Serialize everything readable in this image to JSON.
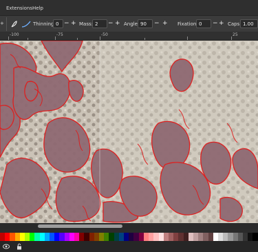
{
  "menu": {
    "items": [
      "Extensions",
      "Help"
    ]
  },
  "toolbar": {
    "thinning": {
      "label": "Thinning:",
      "value": "0"
    },
    "mass": {
      "label": "Mass:",
      "value": "2"
    },
    "angle": {
      "label": "Angle:",
      "value": "90"
    },
    "fixation": {
      "label": "Fixation:",
      "value": "0"
    },
    "caps": {
      "label": "Caps:",
      "value": "1.00"
    },
    "minus": "−",
    "plus": "+"
  },
  "ruler": {
    "labels": [
      "-100",
      "-75",
      "-50",
      "25"
    ]
  },
  "palette": {
    "colors": [
      "#c00000",
      "#ff0000",
      "#ff5500",
      "#ffaa00",
      "#ffff00",
      "#aaff00",
      "#00ff00",
      "#00ffaa",
      "#00ffff",
      "#00aaff",
      "#0055ff",
      "#0000ff",
      "#5500ff",
      "#aa00ff",
      "#ff00ff",
      "#ff00aa",
      "#800000",
      "#400000",
      "#802000",
      "#804000",
      "#808000",
      "#408000",
      "#004000",
      "#004040",
      "#004080",
      "#000080",
      "#200040",
      "#400040",
      "#800040",
      "#ff8080",
      "#ffa0a0",
      "#ffc0c0",
      "#ffe0e0",
      "#c08080",
      "#a06060",
      "#804040",
      "#603030",
      "#402020",
      "#e0c0c0",
      "#c0a0a0",
      "#a08080",
      "#806060",
      "#604040",
      "#ffffff",
      "#dddddd",
      "#bbbbbb",
      "#999999",
      "#777777",
      "#555555",
      "#333333",
      "#111111",
      "#000000"
    ]
  },
  "icons": [
    "pen-icon",
    "curve-icon",
    "eye-icon",
    "lock-icon"
  ]
}
